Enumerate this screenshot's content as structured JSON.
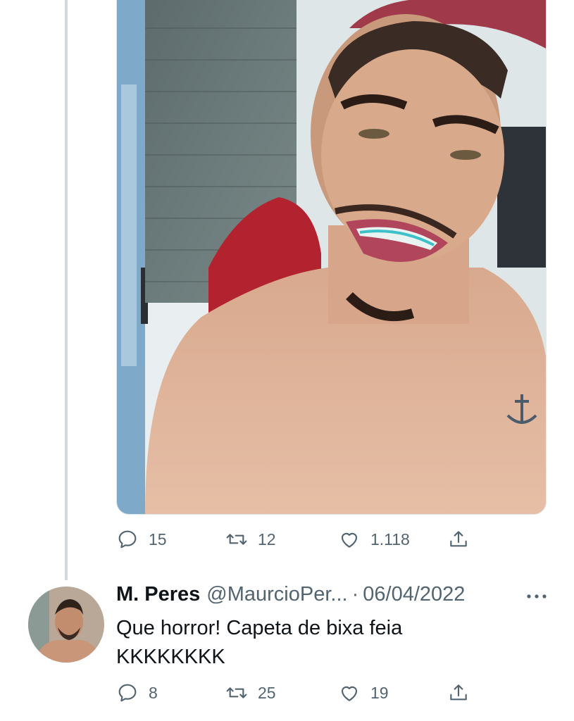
{
  "main_tweet": {
    "media": {
      "description_icon": "photo-of-man-smiling"
    },
    "actions": {
      "replies": "15",
      "retweets": "12",
      "likes": "1.118"
    }
  },
  "reply": {
    "name": "M. Peres",
    "handle": "@MaurcioPer...",
    "separator": "·",
    "date": "06/04/2022",
    "text_line1": "Que horror! Capeta de bixa feia",
    "text_line2": "KKKKKKKK",
    "actions": {
      "replies": "8",
      "retweets": "25",
      "likes": "19"
    }
  },
  "colors": {
    "text_primary": "#0f1419",
    "text_secondary": "#536471",
    "thread_line": "#cfd9de"
  },
  "icons": [
    "reply-icon",
    "retweet-icon",
    "like-icon",
    "share-icon",
    "more-icon"
  ]
}
